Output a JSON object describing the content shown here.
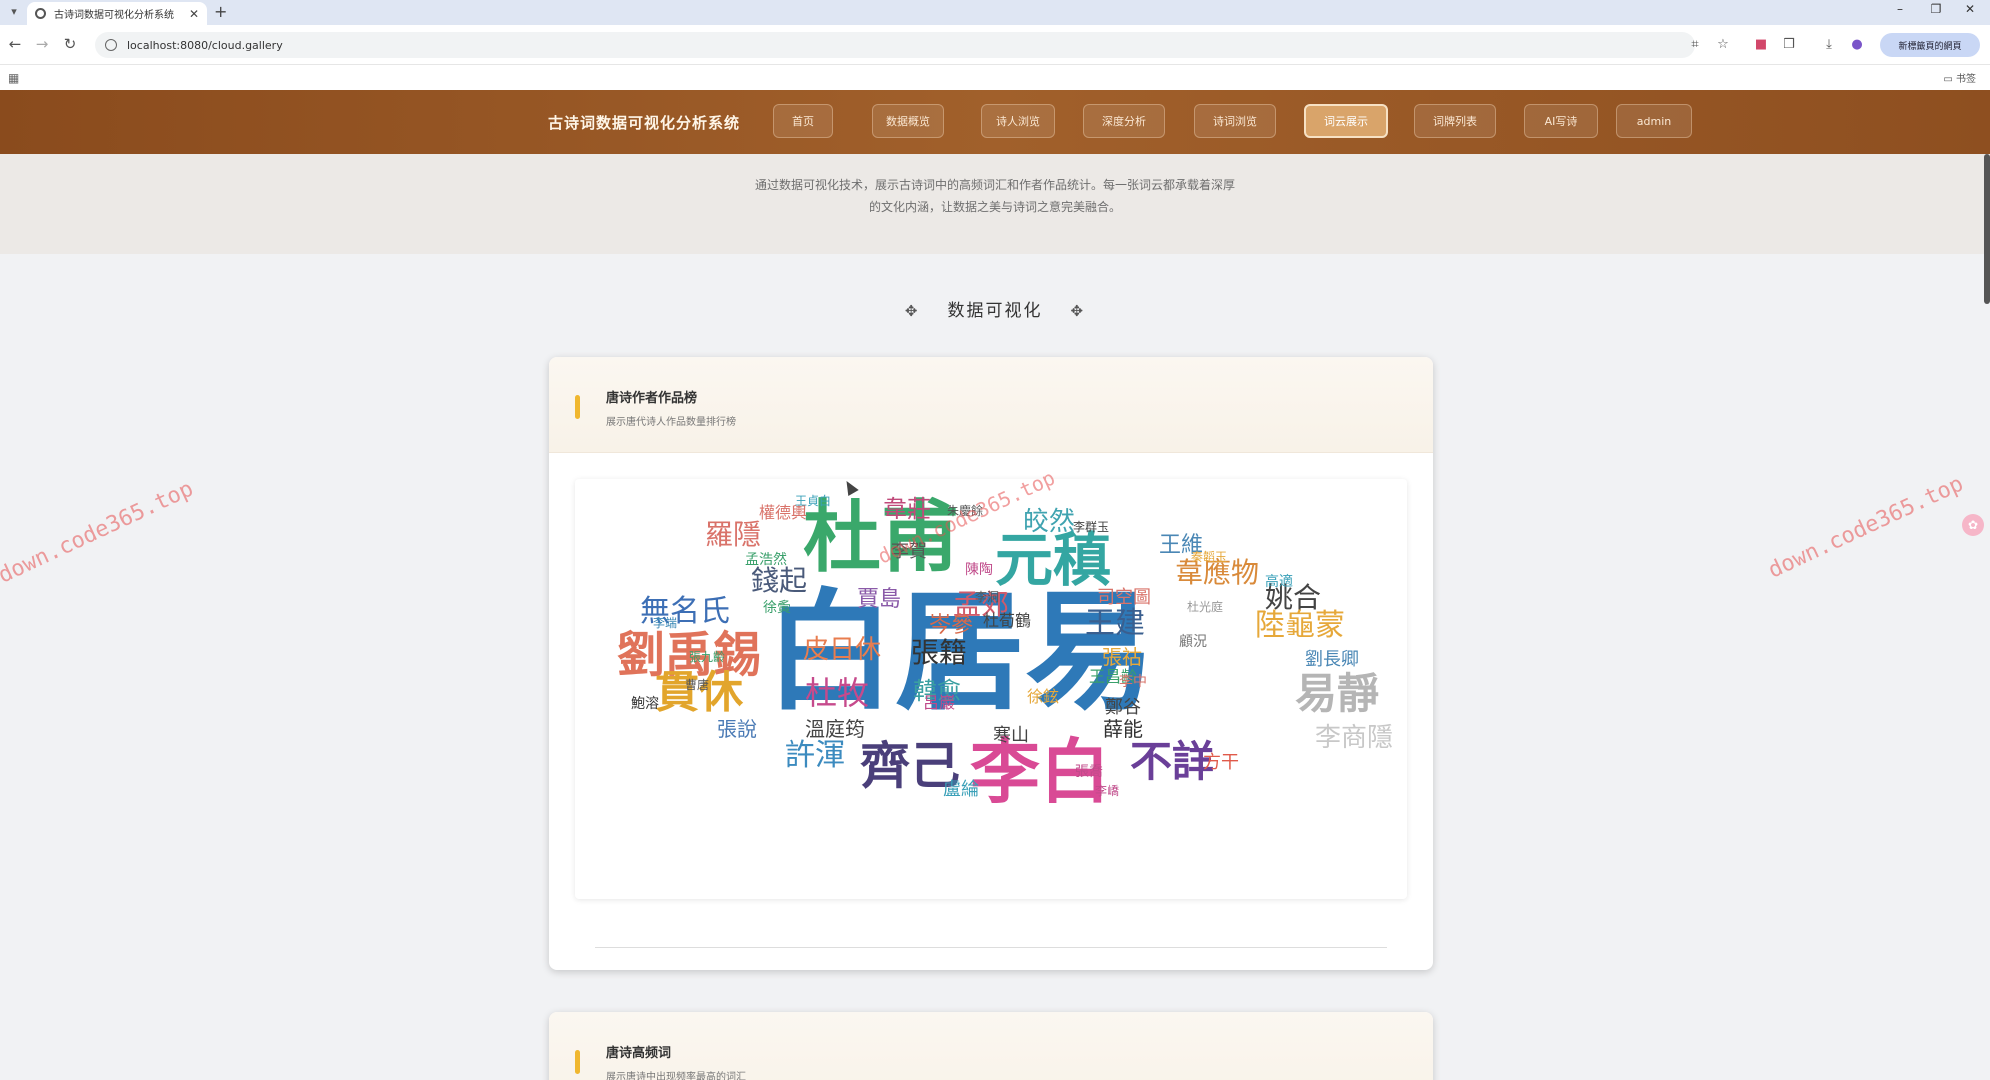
{
  "browser": {
    "tab_title": "古诗词数据可视化分析系统",
    "url": "localhost:8080/cloud.gallery",
    "profile_label": "新標籤頁的網頁"
  },
  "site": {
    "title": "古诗词数据可视化分析系统",
    "nav": [
      {
        "label": "首页"
      },
      {
        "label": "数据概览"
      },
      {
        "label": "诗人浏览"
      },
      {
        "label": "深度分析"
      },
      {
        "label": "诗词浏览"
      },
      {
        "label": "词云展示"
      },
      {
        "label": "词牌列表"
      },
      {
        "label": "AI写诗"
      },
      {
        "label": "admin"
      }
    ],
    "active_nav": "词云展示",
    "intro_line1": "通过数据可视化技术，展示古诗词中的高频词汇和作者作品统计。每一张词云都承载着深厚",
    "intro_line2": "的文化内涵，让数据之美与诗词之意完美融合。",
    "section_title": "数据可视化"
  },
  "cards": [
    {
      "title": "唐诗作者作品榜",
      "subtitle": "展示唐代诗人作品数量排行榜"
    },
    {
      "title": "唐诗高频词",
      "subtitle": "展示唐诗中出现频率最高的词汇"
    }
  ],
  "wordcloud": {
    "words": [
      {
        "text": "白居易",
        "color": "#2e79b8"
      },
      {
        "text": "杜甫",
        "color": "#3aa86b"
      },
      {
        "text": "元稹",
        "color": "#34a6a2"
      },
      {
        "text": "李白",
        "color": "#d94a95"
      },
      {
        "text": "齊己",
        "color": "#4a3f7a"
      },
      {
        "text": "劉禹錫",
        "color": "#e0735a"
      },
      {
        "text": "貫休",
        "color": "#e2a52c"
      },
      {
        "text": "無名氏",
        "color": "#3d6fb5"
      },
      {
        "text": "許渾",
        "color": "#3c8bbf"
      },
      {
        "text": "不詳",
        "color": "#6a3f98"
      },
      {
        "text": "易靜",
        "color": "#b5b5b5"
      },
      {
        "text": "陸龜蒙",
        "color": "#e6a83a"
      },
      {
        "text": "王建",
        "color": "#3a5f8f"
      },
      {
        "text": "韋應物",
        "color": "#d98a3a"
      },
      {
        "text": "姚合",
        "color": "#444444"
      },
      {
        "text": "張籍",
        "color": "#333333"
      },
      {
        "text": "韓愈",
        "color": "#3a9fa1"
      },
      {
        "text": "杜牧",
        "color": "#c64a8c"
      },
      {
        "text": "皮日休",
        "color": "#e87d4f"
      },
      {
        "text": "孟郊",
        "color": "#d05a6a"
      },
      {
        "text": "錢起",
        "color": "#4a5a7a"
      },
      {
        "text": "羅隱",
        "color": "#d9736a"
      },
      {
        "text": "韋莊",
        "color": "#c04a7a"
      },
      {
        "text": "皎然",
        "color": "#3fa3b0"
      },
      {
        "text": "王維",
        "color": "#4a87b5"
      },
      {
        "text": "賈島",
        "color": "#8a5aa8"
      },
      {
        "text": "岑參",
        "color": "#d96a4a"
      },
      {
        "text": "李商隱",
        "color": "#c8c8c8"
      },
      {
        "text": "溫庭筠",
        "color": "#444444"
      },
      {
        "text": "薛能",
        "color": "#333333"
      },
      {
        "text": "張說",
        "color": "#4a7ab5"
      },
      {
        "text": "李賀",
        "color": "#555555"
      },
      {
        "text": "司空圖",
        "color": "#d9736a"
      },
      {
        "text": "鄭谷",
        "color": "#444444"
      },
      {
        "text": "張祜",
        "color": "#e6a83a"
      },
      {
        "text": "劉長卿",
        "color": "#4a87b5"
      },
      {
        "text": "方干",
        "color": "#e05a4a"
      },
      {
        "text": "盧綸",
        "color": "#3aa0b8"
      },
      {
        "text": "寒山",
        "color": "#444444"
      },
      {
        "text": "杜荀鶴",
        "color": "#444444"
      },
      {
        "text": "呂巖",
        "color": "#c04a8a"
      },
      {
        "text": "徐鉉",
        "color": "#e6a83a"
      },
      {
        "text": "權德輿",
        "color": "#d9736a"
      },
      {
        "text": "王昌齡",
        "color": "#3aa06b"
      },
      {
        "text": "李中",
        "color": "#d9736a"
      },
      {
        "text": "孟浩然",
        "color": "#3aa06b"
      },
      {
        "text": "陳陶",
        "color": "#c04a8a"
      },
      {
        "text": "李洞",
        "color": "#555555"
      },
      {
        "text": "李群玉",
        "color": "#444444"
      },
      {
        "text": "高適",
        "color": "#3aa0b8"
      },
      {
        "text": "徐夤",
        "color": "#3aa06b"
      },
      {
        "text": "顧況",
        "color": "#777777"
      },
      {
        "text": "鮑溶",
        "color": "#333333"
      },
      {
        "text": "曹唐",
        "color": "#555555"
      },
      {
        "text": "秦韜玉",
        "color": "#e6a83a"
      },
      {
        "text": "李端",
        "color": "#3a87b5"
      },
      {
        "text": "張喬",
        "color": "#c04a8a"
      },
      {
        "text": "朱慶餘",
        "color": "#555555"
      },
      {
        "text": "李嶠",
        "color": "#c04a8a"
      },
      {
        "text": "王貞白",
        "color": "#3aa0b8"
      },
      {
        "text": "杜光庭",
        "color": "#999999"
      },
      {
        "text": "張九齡",
        "color": "#3aa06b"
      }
    ]
  },
  "watermark": "down.code365.top"
}
